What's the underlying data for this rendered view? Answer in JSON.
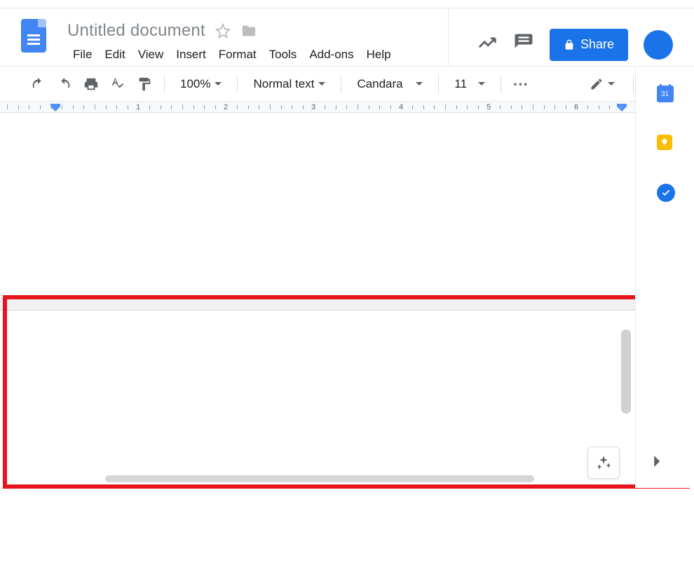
{
  "header": {
    "title": "Untitled document",
    "menus": [
      "File",
      "Edit",
      "View",
      "Insert",
      "Format",
      "Tools",
      "Add-ons",
      "Help"
    ],
    "share_label": "Share"
  },
  "toolbar": {
    "zoom": "100%",
    "style": "Normal text",
    "font": "Candara",
    "font_size": "11",
    "more": "⋯"
  },
  "ruler": {
    "marks": [
      "1",
      "2",
      "3",
      "4",
      "5",
      "6"
    ]
  },
  "side": {
    "calendar_day": "31"
  }
}
